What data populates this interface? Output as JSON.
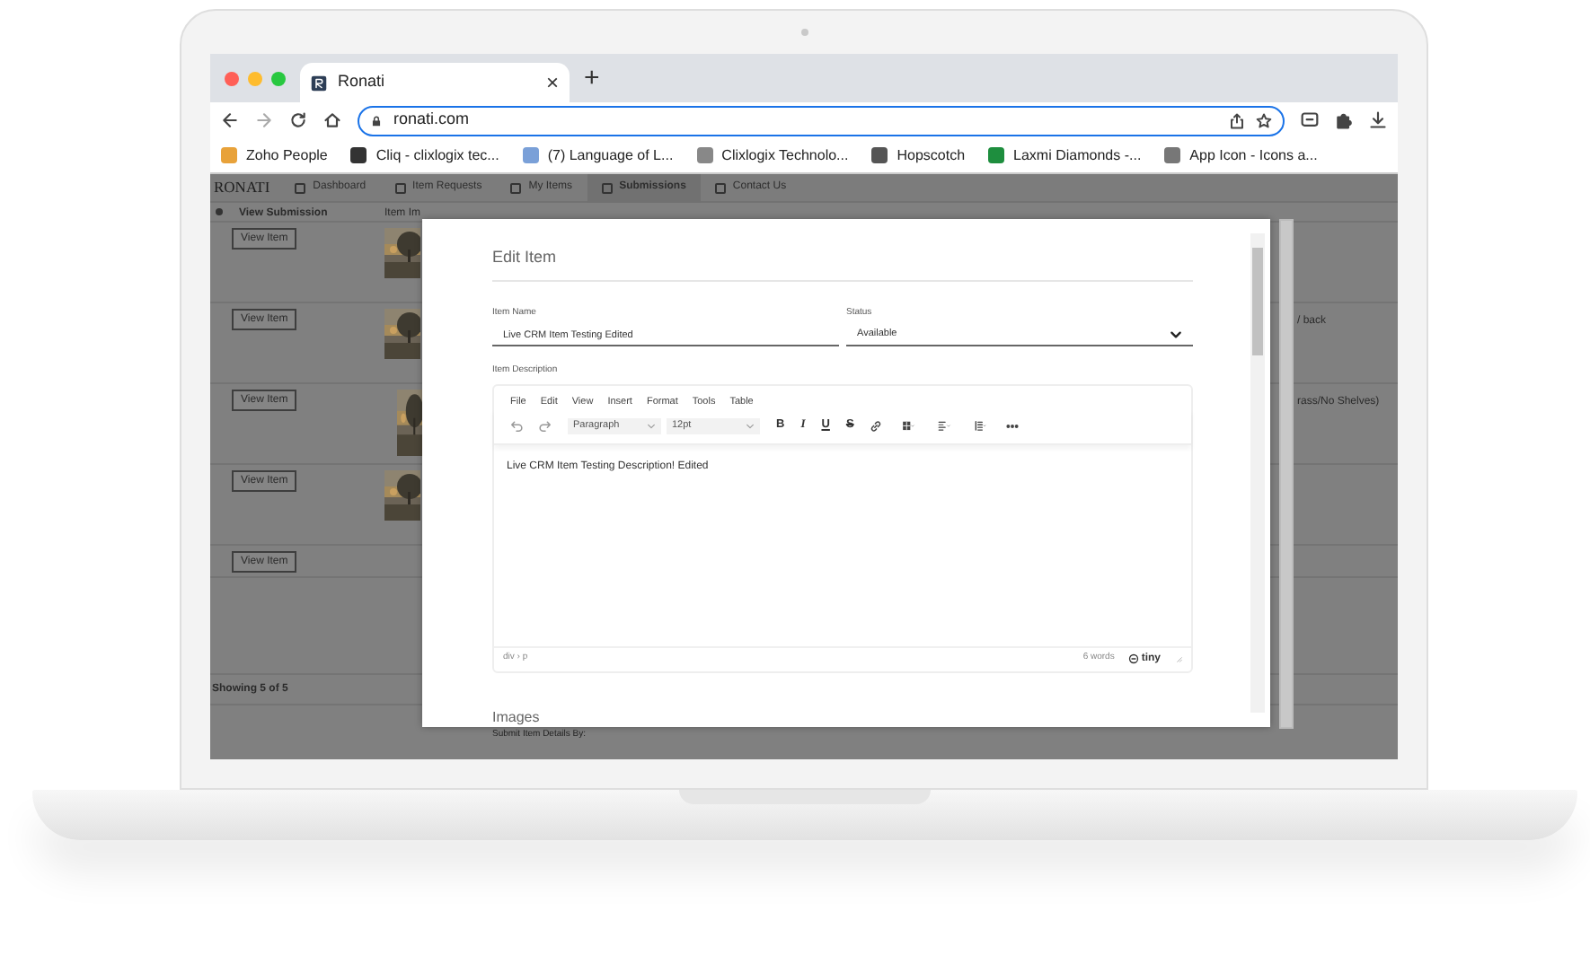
{
  "browser": {
    "tab_title": "Ronati",
    "tab_close": "×",
    "new_tab": "+",
    "url": "ronati.com",
    "bookmarks": [
      {
        "label": "Zoho People",
        "color": "#e8a23a"
      },
      {
        "label": "Cliq - clixlogix tec...",
        "color": "#333333"
      },
      {
        "label": "(7) Language of L...",
        "color": "#7aa0d8"
      },
      {
        "label": "Clixlogix Technolo...",
        "color": "#888888"
      },
      {
        "label": "Hopscotch",
        "color": "#555555"
      },
      {
        "label": "Laxmi Diamonds -...",
        "color": "#1e8e3e"
      },
      {
        "label": "App Icon - Icons a...",
        "color": "#777777"
      }
    ]
  },
  "app": {
    "logo": "RONATI",
    "nav": [
      {
        "label": "Dashboard",
        "selected": false
      },
      {
        "label": "Item Requests",
        "selected": false
      },
      {
        "label": "My Items",
        "selected": false
      },
      {
        "label": "Submissions",
        "selected": true
      },
      {
        "label": "Contact Us",
        "selected": false
      }
    ],
    "table": {
      "columns": [
        "View Submission",
        "Item Im"
      ],
      "rows": [
        {
          "action": "View Item"
        },
        {
          "action": "View Item",
          "note": "/ back"
        },
        {
          "action": "View Item",
          "note": "rass/No Shelves)"
        },
        {
          "action": "View Item"
        },
        {
          "action": "View Item"
        }
      ]
    },
    "footer": "Showing 5 of 5",
    "behind_text": "Submit Item Details By:"
  },
  "modal": {
    "title": "Edit Item",
    "fields": [
      {
        "label": "Item Name",
        "value": "Live CRM Item Testing Edited",
        "kind": "text"
      },
      {
        "label": "Status",
        "value": "Available",
        "kind": "select"
      }
    ],
    "description_label": "Item Description",
    "editor": {
      "menu": [
        "File",
        "Edit",
        "View",
        "Insert",
        "Format",
        "Tools",
        "Table"
      ],
      "block_format": "Paragraph",
      "font_size": "12pt",
      "format_buttons": [
        "B",
        "I",
        "U",
        "S"
      ],
      "content": "Live CRM Item Testing Description! Edited",
      "path": "div › p",
      "word_count": "6 words",
      "brand": "tiny"
    },
    "next_section": "Images"
  }
}
